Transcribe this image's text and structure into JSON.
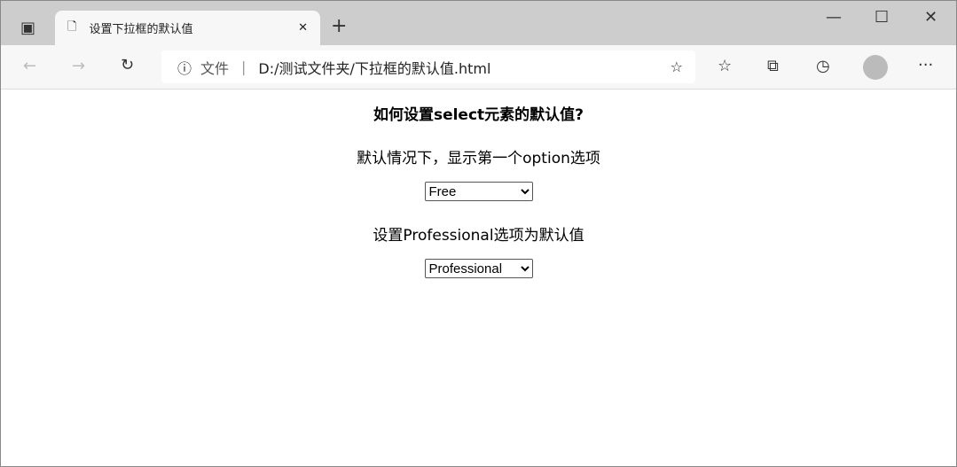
{
  "browser": {
    "tab_title": "设置下拉框的默认值",
    "address_label": "文件",
    "url": "D:/测试文件夹/下拉框的默认值.html"
  },
  "page": {
    "heading": "如何设置select元素的默认值?",
    "text1": "默认情况下，显示第一个option选项",
    "select1": "Free",
    "text2": "设置Professional选项为默认值",
    "select2": "Professional"
  }
}
